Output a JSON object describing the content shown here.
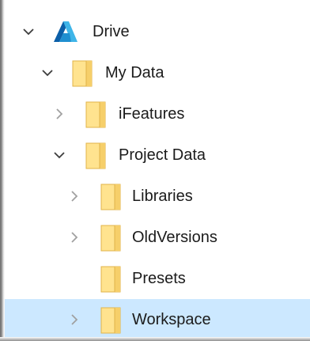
{
  "tree": {
    "root": {
      "label": "Drive",
      "icon": "autodesk-drive-icon",
      "expanded": true
    },
    "items": [
      {
        "label": "My Data",
        "level": 1,
        "expander": "expanded",
        "icon": "folder-icon"
      },
      {
        "label": "iFeatures",
        "level": 2,
        "expander": "collapsed",
        "icon": "folder-icon"
      },
      {
        "label": "Project Data",
        "level": 2,
        "expander": "expanded",
        "icon": "folder-icon"
      },
      {
        "label": "Libraries",
        "level": 3,
        "expander": "collapsed",
        "icon": "folder-icon"
      },
      {
        "label": "OldVersions",
        "level": 3,
        "expander": "collapsed",
        "icon": "folder-icon"
      },
      {
        "label": "Presets",
        "level": 3,
        "expander": "none",
        "icon": "folder-icon"
      },
      {
        "label": "Workspace",
        "level": 3,
        "expander": "collapsed",
        "icon": "folder-icon",
        "selected": true
      }
    ]
  },
  "colors": {
    "selection": "#cce8ff",
    "folder_fill": "#ffe38f",
    "folder_edge": "#e0b34a",
    "chevron_expanded": "#3c3c3c",
    "chevron_collapsed": "#a0a0a0",
    "brand_blue_dark": "#0b5fa8",
    "brand_blue_light": "#3fb5e8"
  }
}
